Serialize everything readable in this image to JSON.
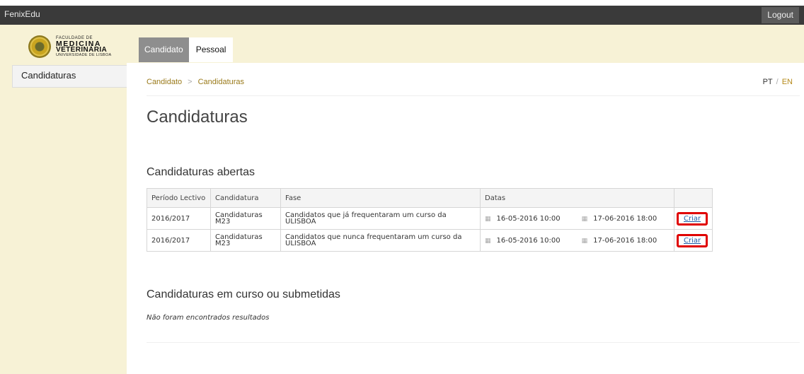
{
  "app": {
    "name": "FenixEdu",
    "logout_label": "Logout"
  },
  "logo": {
    "line1": "FACULDADE DE",
    "line2": "MEDICINA",
    "line3": "VETERINÁRIA",
    "line4": "UNIVERSIDADE DE LISBOA"
  },
  "tabs": [
    {
      "label": "Candidato",
      "active": true
    },
    {
      "label": "Pessoal",
      "active": false
    }
  ],
  "sidebar": {
    "items": [
      {
        "label": "Candidaturas"
      }
    ]
  },
  "breadcrumb": [
    "Candidato",
    "Candidaturas"
  ],
  "breadcrumb_sep": ">",
  "lang": {
    "pt": "PT",
    "sep": "/",
    "en": "EN"
  },
  "page_title": "Candidaturas",
  "open": {
    "title": "Candidaturas abertas",
    "headers": [
      "Período Lectivo",
      "Candidatura",
      "Fase",
      "Datas",
      ""
    ],
    "rows": [
      {
        "periodo": "2016/2017",
        "candidatura": "Candidaturas M23",
        "fase": "Candidatos que já frequentaram um curso da ULISBOA",
        "start": "16-05-2016 10:00",
        "end": "17-06-2016 18:00",
        "action": "Criar"
      },
      {
        "periodo": "2016/2017",
        "candidatura": "Candidaturas M23",
        "fase": "Candidatos que nunca frequentaram um curso da ULISBOA",
        "start": "16-05-2016 10:00",
        "end": "17-06-2016 18:00",
        "action": "Criar"
      }
    ]
  },
  "submitted": {
    "title": "Candidaturas em curso ou submetidas",
    "empty_message": "Não foram encontrados resultados"
  },
  "icons": {
    "calendar": "calendar-icon"
  },
  "colors": {
    "topbar": "#3a3a3a",
    "band": "#f7f2d6",
    "accent": "#9a7a1a",
    "highlight": "#e00000",
    "link": "#1e5aa8"
  }
}
